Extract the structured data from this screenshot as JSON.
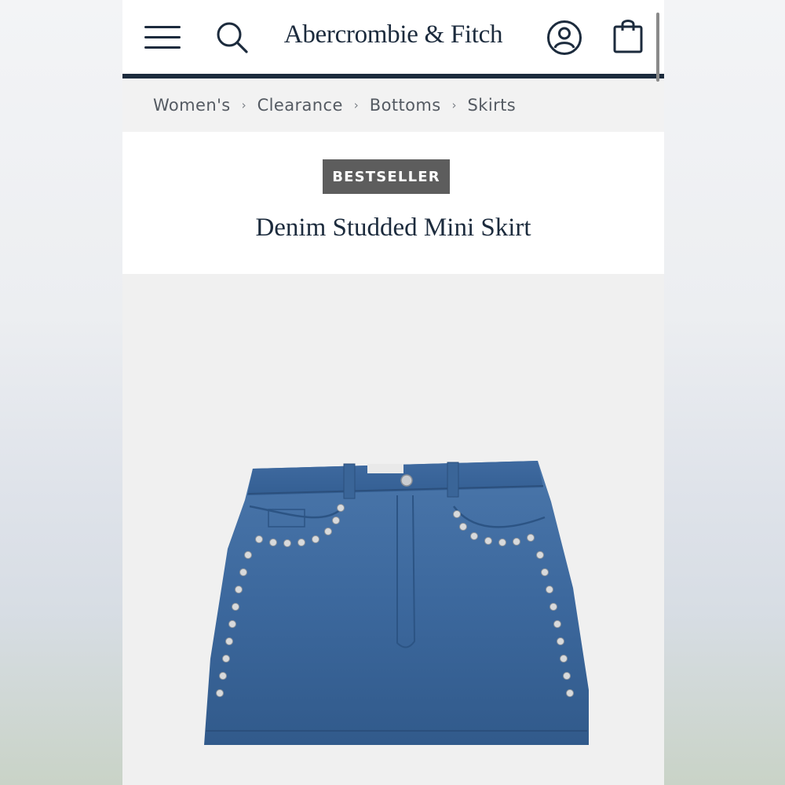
{
  "header": {
    "menu_icon": "hamburger-menu-icon",
    "search_icon": "search-icon",
    "logo_text": "Abercrombie & Fitch",
    "account_icon": "account-icon",
    "bag_icon": "shopping-bag-icon"
  },
  "breadcrumb": {
    "items": [
      "Women's",
      "Clearance",
      "Bottoms",
      "Skirts"
    ],
    "separator_icon": "chevron-right-icon"
  },
  "product": {
    "badge": "BESTSELLER",
    "title": "Denim Studded Mini Skirt",
    "image_alt": "denim-studded-mini-skirt-photo"
  },
  "colors": {
    "brand_navy": "#1c2b3d",
    "badge_gray": "#5d5d5d",
    "denim_blue": "#3f6ba1"
  }
}
